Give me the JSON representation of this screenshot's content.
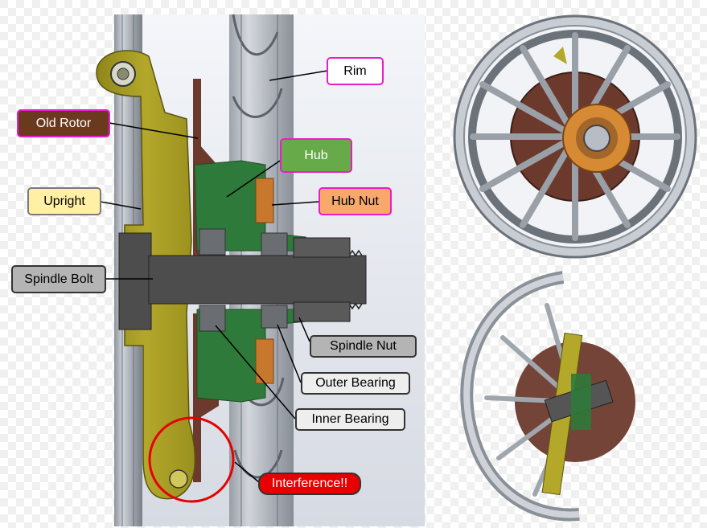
{
  "labels": {
    "rim": "Rim",
    "old_rotor": "Old Rotor",
    "hub": "Hub",
    "upright": "Upright",
    "hub_nut": "Hub Nut",
    "spindle_bolt": "Spindle Bolt",
    "spindle_nut": "Spindle Nut",
    "outer_bearing": "Outer Bearing",
    "inner_bearing": "Inner Bearing",
    "interference": "Interference!!"
  },
  "colors": {
    "upright": "#b3a82a",
    "hub": "#2e7a3a",
    "rotor": "#6b3a2c",
    "hub_nut": "#c8782c",
    "spindle": "#4d4d4d",
    "bearing": "#6a6e72",
    "rim": "#b6bbc4",
    "label_old_rotor_bg": "#6b3a1e",
    "label_hub_bg": "#66aa4a",
    "label_upright_bg": "#fff0a6",
    "label_hub_nut_bg": "#f7a86a",
    "label_interference_bg": "#e60000",
    "magenta_border": "#e61ec8",
    "interference_circle": "#e60000"
  }
}
